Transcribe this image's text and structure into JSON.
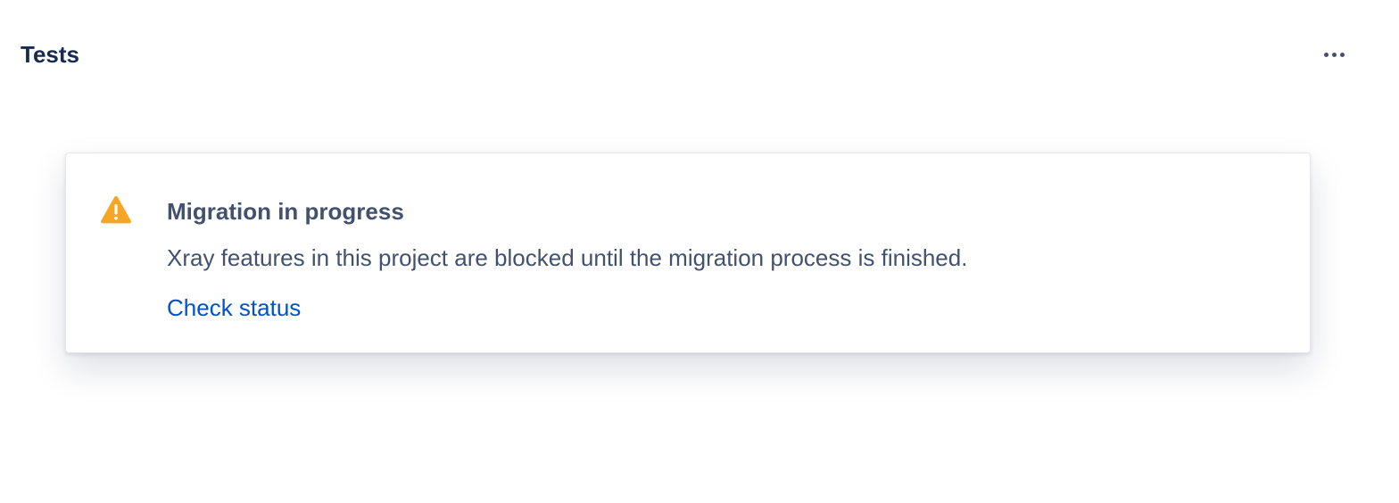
{
  "header": {
    "title": "Tests",
    "more_icon": "more-horizontal-icon"
  },
  "banner": {
    "icon": "warning-icon",
    "icon_color": "#f6a623",
    "title": "Migration in progress",
    "message": "Xray features in this project are blocked until the migration process is finished.",
    "link_label": "Check status"
  },
  "colors": {
    "heading": "#172b4d",
    "text": "#42526e",
    "link": "#0052cc"
  }
}
